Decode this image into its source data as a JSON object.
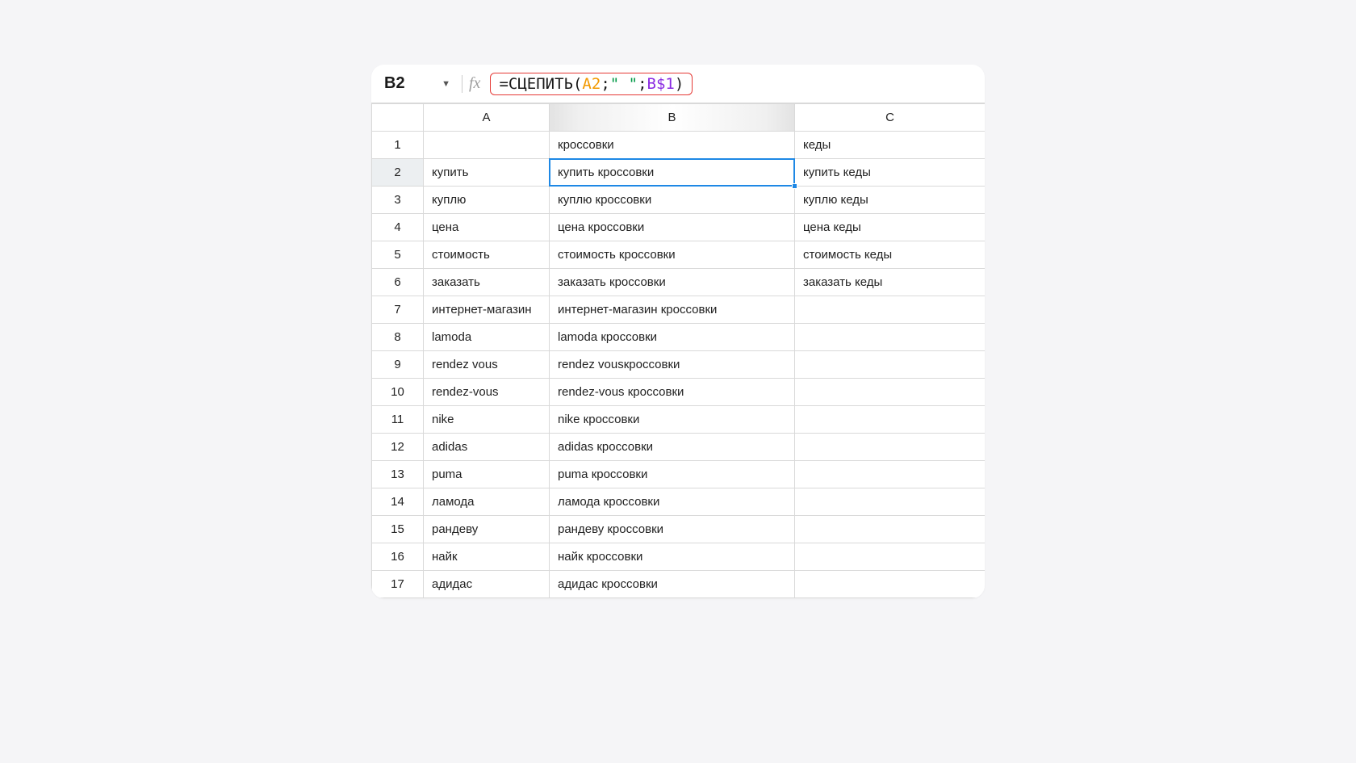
{
  "nameBox": "B2",
  "formula": {
    "prefix": "=",
    "fn": "СЦЕПИТЬ",
    "open": "(",
    "ref1": "A2",
    "sep1": ";",
    "str": "\"  \"",
    "sep2": ";",
    "ref2": "B$1",
    "close": ")"
  },
  "columns": [
    "A",
    "B",
    "C"
  ],
  "selected": {
    "row": 2,
    "col": "B"
  },
  "rows": [
    {
      "n": 1,
      "A": "",
      "B": "кроссовки",
      "C": "кеды"
    },
    {
      "n": 2,
      "A": "купить",
      "B": "купить кроссовки",
      "C": "купить кеды"
    },
    {
      "n": 3,
      "A": "куплю",
      "B": "куплю кроссовки",
      "C": "куплю кеды"
    },
    {
      "n": 4,
      "A": "цена",
      "B": "цена кроссовки",
      "C": "цена кеды"
    },
    {
      "n": 5,
      "A": "стоимость",
      "B": "стоимость кроссовки",
      "C": "стоимость кеды"
    },
    {
      "n": 6,
      "A": "заказать",
      "B": "заказать кроссовки",
      "C": "заказать кеды"
    },
    {
      "n": 7,
      "A": "интернет-магазин",
      "B": "интернет-магазин кроссовки",
      "C": ""
    },
    {
      "n": 8,
      "A": "lamoda",
      "B": "lamoda кроссовки",
      "C": ""
    },
    {
      "n": 9,
      "A": "rendez vous",
      "B": "rendez vousкроссовки",
      "C": ""
    },
    {
      "n": 10,
      "A": "rendez-vous",
      "B": "rendez-vous кроссовки",
      "C": ""
    },
    {
      "n": 11,
      "A": "nike",
      "B": "nike кроссовки",
      "C": ""
    },
    {
      "n": 12,
      "A": "adidas",
      "B": "adidas кроссовки",
      "C": ""
    },
    {
      "n": 13,
      "A": "puma",
      "B": "puma кроссовки",
      "C": ""
    },
    {
      "n": 14,
      "A": "ламода",
      "B": "ламода кроссовки",
      "C": ""
    },
    {
      "n": 15,
      "A": "рандеву",
      "B": "рандеву кроссовки",
      "C": ""
    },
    {
      "n": 16,
      "A": "найк",
      "B": "найк кроссовки",
      "C": ""
    },
    {
      "n": 17,
      "A": "адидас",
      "B": "адидас кроссовки",
      "C": ""
    }
  ]
}
